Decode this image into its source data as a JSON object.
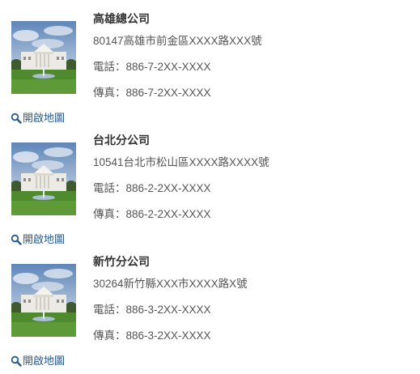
{
  "offices": [
    {
      "name": "高雄總公司",
      "address": "80147高雄市前金區XXXX路XXX號",
      "phone": "電話：886-7-2XX-XXXX",
      "fax": "傳真：886-7-2XX-XXXX",
      "map_link": "開啟地圖",
      "icon": "search-icon"
    },
    {
      "name": "台北分公司",
      "address": "10541台北市松山區XXXX路XXXX號",
      "phone": "電話：886-2-2XX-XXXX",
      "fax": "傳真：886-2-2XX-XXXX",
      "map_link": "開啟地圖",
      "icon": "search-icon"
    },
    {
      "name": "新竹分公司",
      "address": "30264新竹縣XXX市XXXX路X號",
      "phone": "電話：886-3-2XX-XXXX",
      "fax": "傳真：886-3-2XX-XXXX",
      "map_link": "開啟地圖",
      "icon": "search-icon"
    }
  ],
  "colors": {
    "link": "#2a5a8a",
    "heading": "#333333",
    "text": "#555555"
  }
}
